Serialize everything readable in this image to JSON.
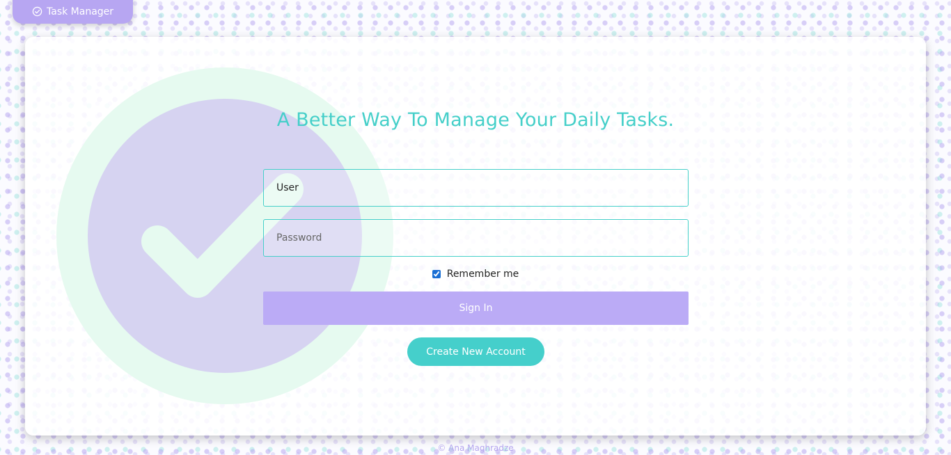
{
  "brand": {
    "label": "Task Manager",
    "icon": "check-circle-icon"
  },
  "hero": {
    "icon": "checkmark-badge-icon",
    "colors": {
      "outer": "#e6faf0",
      "inner": "#d6d3f1",
      "check": "#e6faf0"
    }
  },
  "headline": "A Better Way To Manage Your Daily Tasks.",
  "form": {
    "user_value": "User",
    "password_placeholder": "Password",
    "remember_label": "Remember me",
    "remember_checked": true,
    "signin_label": "Sign In",
    "create_label": "Create New Account"
  },
  "footer": "© Ana Maghradze",
  "colors": {
    "accent_teal": "#45cfc9",
    "accent_purple": "#b7a6f2",
    "signin_button": "#bbabf6"
  }
}
